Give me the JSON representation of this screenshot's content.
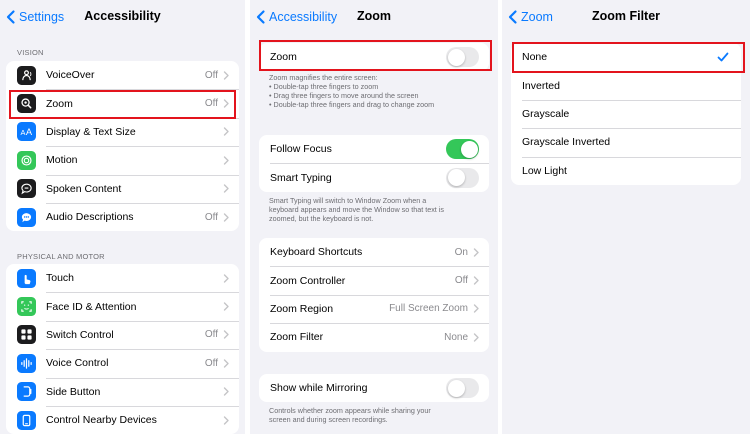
{
  "pane1": {
    "back_label": "Settings",
    "title": "Accessibility",
    "sections": [
      {
        "header": "VISION",
        "items": [
          {
            "label": "VoiceOver",
            "value": "Off",
            "icon": "voiceover-icon",
            "color": "#1c1c1e"
          },
          {
            "label": "Zoom",
            "value": "Off",
            "icon": "zoom-icon",
            "color": "#1c1c1e"
          },
          {
            "label": "Display & Text Size",
            "value": "",
            "icon": "text-size-icon",
            "color": "#0a7aff"
          },
          {
            "label": "Motion",
            "value": "",
            "icon": "motion-icon",
            "color": "#34c759"
          },
          {
            "label": "Spoken Content",
            "value": "",
            "icon": "spoken-content-icon",
            "color": "#1c1c1e"
          },
          {
            "label": "Audio Descriptions",
            "value": "Off",
            "icon": "audio-descriptions-icon",
            "color": "#0a7aff"
          }
        ]
      },
      {
        "header": "PHYSICAL AND MOTOR",
        "items": [
          {
            "label": "Touch",
            "value": "",
            "icon": "touch-icon",
            "color": "#0a7aff"
          },
          {
            "label": "Face ID & Attention",
            "value": "",
            "icon": "face-id-icon",
            "color": "#34c759"
          },
          {
            "label": "Switch Control",
            "value": "Off",
            "icon": "switch-control-icon",
            "color": "#1c1c1e"
          },
          {
            "label": "Voice Control",
            "value": "Off",
            "icon": "voice-control-icon",
            "color": "#0a7aff"
          },
          {
            "label": "Side Button",
            "value": "",
            "icon": "side-button-icon",
            "color": "#0a7aff"
          },
          {
            "label": "Control Nearby Devices",
            "value": "",
            "icon": "nearby-devices-icon",
            "color": "#0a7aff"
          }
        ]
      }
    ]
  },
  "pane2": {
    "back_label": "Accessibility",
    "title": "Zoom",
    "zoom_label": "Zoom",
    "zoom_on": false,
    "zoom_footer": [
      "Zoom magnifies the entire screen:",
      "• Double-tap three fingers to zoom",
      "• Drag three fingers to move around the screen",
      "• Double-tap three fingers and drag to change zoom"
    ],
    "follow_focus_label": "Follow Focus",
    "follow_focus_on": true,
    "smart_typing_label": "Smart Typing",
    "smart_typing_on": false,
    "smart_typing_footer": [
      "Smart Typing will switch to Window Zoom when a",
      "keyboard appears and move the Window so that text is",
      "zoomed, but the keyboard is not."
    ],
    "options": [
      {
        "label": "Keyboard Shortcuts",
        "value": "On"
      },
      {
        "label": "Zoom Controller",
        "value": "Off"
      },
      {
        "label": "Zoom Region",
        "value": "Full Screen Zoom"
      },
      {
        "label": "Zoom Filter",
        "value": "None"
      }
    ],
    "mirroring_label": "Show while Mirroring",
    "mirroring_on": false,
    "mirroring_footer": [
      "Controls whether zoom appears while sharing your",
      "screen and during screen recordings."
    ]
  },
  "pane3": {
    "back_label": "Zoom",
    "title": "Zoom Filter",
    "filters": [
      {
        "label": "None",
        "selected": true
      },
      {
        "label": "Inverted",
        "selected": false
      },
      {
        "label": "Grayscale",
        "selected": false
      },
      {
        "label": "Grayscale Inverted",
        "selected": false
      },
      {
        "label": "Low Light",
        "selected": false
      }
    ]
  },
  "colors": {
    "accent": "#0a7aff",
    "toggle_on": "#34c759",
    "highlight": "#e3141d",
    "background": "#f2f2f7"
  }
}
